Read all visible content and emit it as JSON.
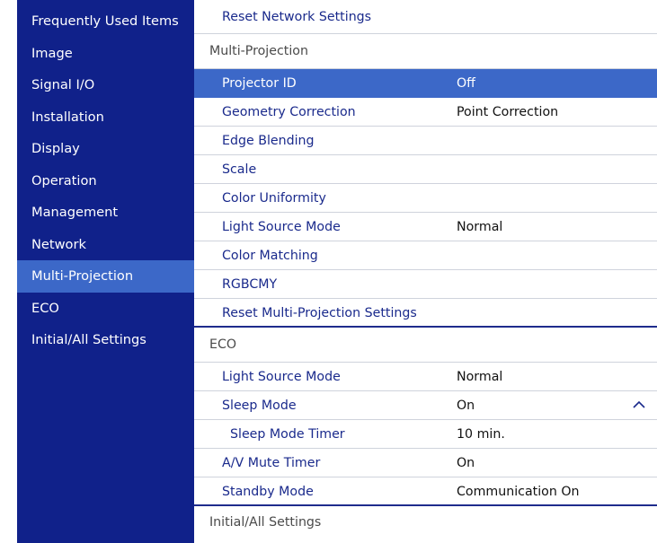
{
  "sidebar": {
    "items": [
      {
        "label": "Frequently Used Items"
      },
      {
        "label": "Image"
      },
      {
        "label": "Signal I/O"
      },
      {
        "label": "Installation"
      },
      {
        "label": "Display"
      },
      {
        "label": "Operation"
      },
      {
        "label": "Management"
      },
      {
        "label": "Network"
      },
      {
        "label": "Multi-Projection"
      },
      {
        "label": "ECO"
      },
      {
        "label": "Initial/All Settings"
      }
    ],
    "active_index": 8
  },
  "main": {
    "reset_network": "Reset Network Settings",
    "multi_projection": {
      "header": "Multi-Projection",
      "items": [
        {
          "label": "Projector ID",
          "value": "Off"
        },
        {
          "label": "Geometry Correction",
          "value": "Point Correction"
        },
        {
          "label": "Edge Blending",
          "value": ""
        },
        {
          "label": "Scale",
          "value": ""
        },
        {
          "label": "Color Uniformity",
          "value": ""
        },
        {
          "label": "Light Source Mode",
          "value": "Normal"
        },
        {
          "label": "Color Matching",
          "value": ""
        },
        {
          "label": "RGBCMY",
          "value": ""
        },
        {
          "label": "Reset Multi-Projection Settings",
          "value": ""
        }
      ]
    },
    "eco": {
      "header": "ECO",
      "items": [
        {
          "label": "Light Source Mode",
          "value": "Normal"
        },
        {
          "label": "Sleep Mode",
          "value": "On"
        },
        {
          "label": "Sleep Mode Timer",
          "value": "10 min."
        },
        {
          "label": "A/V Mute Timer",
          "value": "On"
        },
        {
          "label": "Standby Mode",
          "value": "Communication On"
        }
      ]
    },
    "initial_header": "Initial/All Settings",
    "scroll_icon": "chevron-up-icon"
  },
  "colors": {
    "sidebar_bg": "#10218a",
    "selected_bg": "#3c68c8",
    "menu_text": "#1a2a8c"
  }
}
